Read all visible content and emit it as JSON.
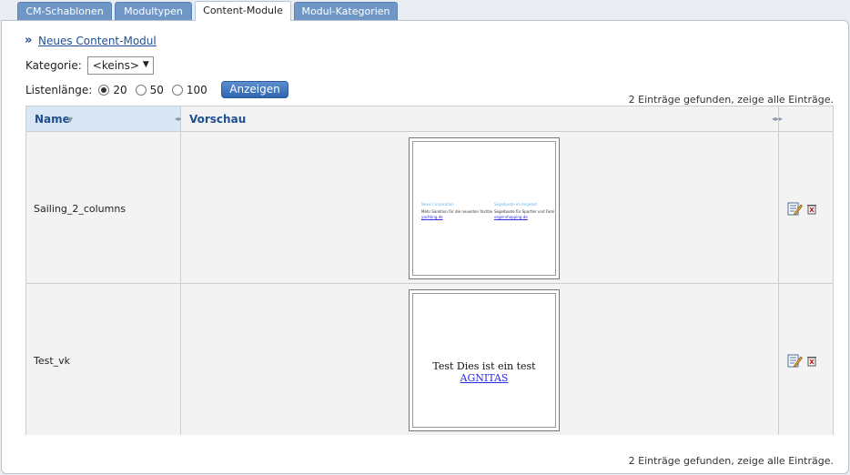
{
  "tabs": [
    {
      "label": "CM-Schablonen",
      "active": false
    },
    {
      "label": "Modultypen",
      "active": false
    },
    {
      "label": "Content-Module",
      "active": true
    },
    {
      "label": "Modul-Kategorien",
      "active": false
    }
  ],
  "new_module": {
    "label": "Neues Content-Modul",
    "icon": "double-chevron-icon"
  },
  "category": {
    "label": "Kategorie:",
    "selected": "<keins>"
  },
  "list_length": {
    "label": "Listenlänge:",
    "options": [
      "20",
      "50",
      "100"
    ],
    "selected": "20"
  },
  "show_button": {
    "label": "Anzeigen"
  },
  "results_text": "2 Einträge gefunden, zeige alle Einträge.",
  "table": {
    "headers": {
      "name": "Name",
      "preview": "Vorschau"
    },
    "rows": [
      {
        "name": "Sailing_2_columns",
        "preview": {
          "col1_heading": "News Corporation",
          "col1_text": "Mehr Sanktion für die neuesten Yachten",
          "col1_link": "yachting.de",
          "col2_heading": "Segelboote im Angebot",
          "col2_text": "Segelboote für Sportler und Familien",
          "col2_link": "segel-shopping.de"
        }
      },
      {
        "name": "Test_vk",
        "preview": {
          "text": "Test Dies ist ein test",
          "link": "AGNITAS"
        }
      }
    ]
  },
  "colors": {
    "tab": "#6f97c6",
    "accent": "#1f4f8f",
    "button": "#2f64ad"
  }
}
